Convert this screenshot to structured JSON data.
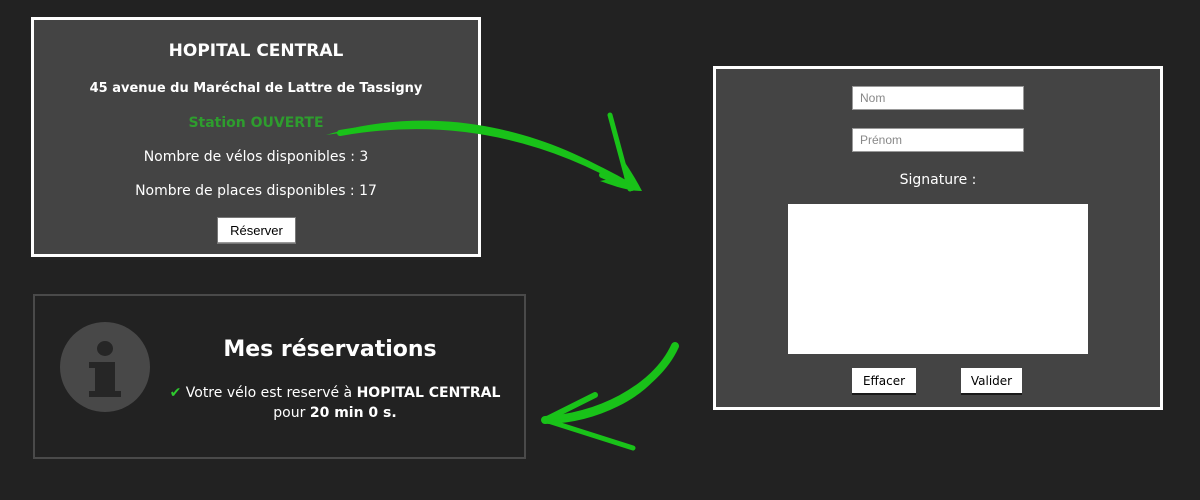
{
  "station": {
    "name": "HOPITAL CENTRAL",
    "address": "45 avenue du Maréchal de Lattre de Tassigny",
    "status": "Station OUVERTE",
    "bikes": "Nombre de vélos disponibles : 3",
    "places": "Nombre de places disponibles : 17",
    "reserve_label": "Réserver",
    "status_color": "#2e9d2e"
  },
  "reservations": {
    "title": "Mes réservations",
    "text_before": "Votre vélo est reservé à",
    "station": "HOPITAL CENTRAL",
    "text_for": "pour",
    "duration": "20 min 0 s.",
    "check_glyph": "✔",
    "info_glyph": "i"
  },
  "form": {
    "nom_placeholder": "Nom",
    "prenom_placeholder": "Prénom",
    "signature_label": "Signature :",
    "clear_label": "Effacer",
    "submit_label": "Valider"
  },
  "colors": {
    "background": "#222222",
    "panel": "#444444",
    "arrow": "#19c219"
  }
}
